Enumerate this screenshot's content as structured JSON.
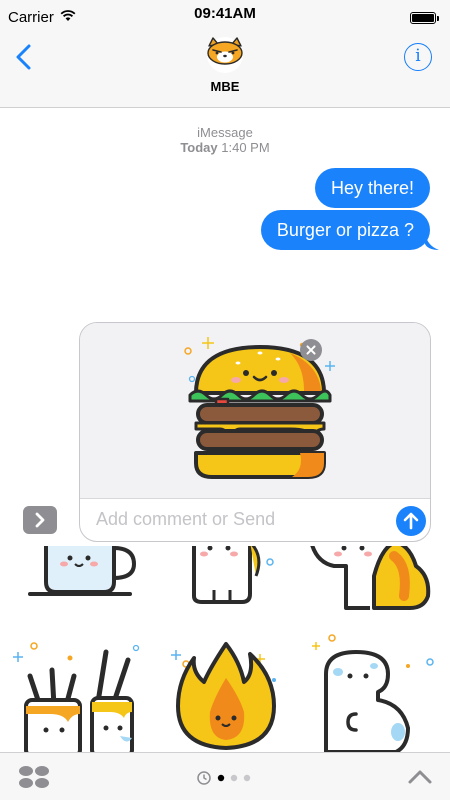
{
  "status_bar": {
    "carrier": "Carrier",
    "time": "09:41AM"
  },
  "nav": {
    "contact_name": "MBE",
    "info_label": "i"
  },
  "conversation": {
    "service": "iMessage",
    "day": "Today",
    "time": "1:40 PM",
    "messages": [
      {
        "text": "Hey there!",
        "sender": "me"
      },
      {
        "text": "Burger or pizza ?",
        "sender": "me"
      }
    ]
  },
  "compose": {
    "placeholder": "Add comment or Send",
    "attached_sticker": "burger-sticker"
  },
  "drawer": {
    "stickers": [
      "mug-sticker",
      "character-sticker",
      "fries-sticker",
      "paint-brush-sticker",
      "flame-sticker",
      "dinosaur-sticker"
    ]
  },
  "bottom_bar": {
    "current_page": 1,
    "page_count": 3
  },
  "colors": {
    "accent": "#1a82fb",
    "bar_bg": "#f7f7f7",
    "muted": "#8e8e93"
  }
}
